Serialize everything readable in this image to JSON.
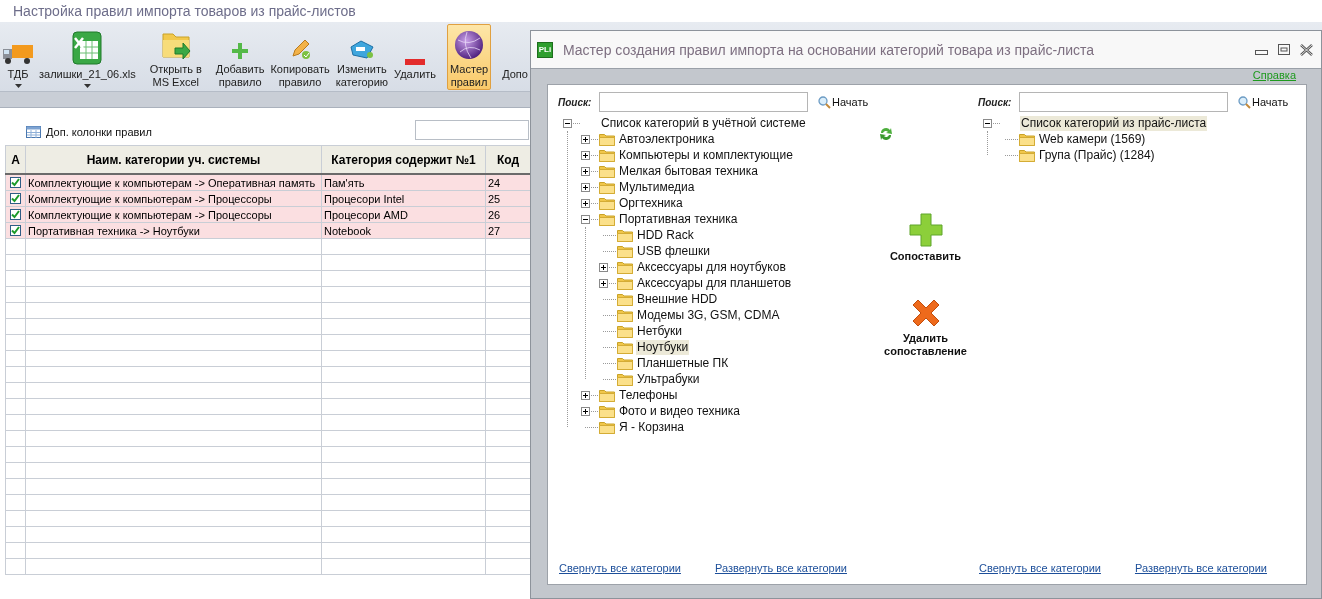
{
  "window": {
    "title": "Настройка правил импорта товаров из прайс-листов"
  },
  "toolbar_groups": [
    [
      {
        "kind": "truck",
        "label": "ТДБ",
        "dropdown": true,
        "selected": false
      },
      {
        "kind": "spreadsheet",
        "label": "залишки_21_06.xls",
        "dropdown": true,
        "selected": false
      }
    ],
    [
      {
        "kind": "folder-arrow",
        "label": "Открыть в\nMS Excel",
        "dropdown": false,
        "selected": false
      }
    ],
    [
      {
        "kind": "plus",
        "label": "Добавить\nправило",
        "dropdown": false,
        "selected": false
      },
      {
        "kind": "pencil",
        "label": "Копировать\nправило",
        "dropdown": false,
        "selected": false
      },
      {
        "kind": "tag",
        "label": "Изменить\nкатегорию",
        "dropdown": false,
        "selected": false
      },
      {
        "kind": "minus",
        "label": "Удалить",
        "dropdown": false,
        "selected": false
      }
    ],
    [
      {
        "kind": "globe",
        "label": "Мастер\nправил",
        "dropdown": false,
        "selected": true
      }
    ],
    [
      {
        "label": "Допо",
        "dropdown": false,
        "selected": false
      }
    ]
  ],
  "extra_columns_button": "Доп. колонки правил",
  "rules_table": {
    "check_column": "А",
    "columns": [
      "Наим. категории уч. системы",
      "Категория содержит №1",
      "Код"
    ],
    "rows": [
      {
        "checked": true,
        "cells": [
          "Комплектующие к компьютерам -> Оперативная память",
          "Пам'ять",
          "24"
        ]
      },
      {
        "checked": true,
        "cells": [
          "Комплектующие к компьютерам -> Процессоры",
          "Процесори Intel",
          "25"
        ]
      },
      {
        "checked": true,
        "cells": [
          "Комплектующие к компьютерам -> Процессоры",
          "Процесори AMD",
          "26"
        ]
      },
      {
        "checked": true,
        "cells": [
          "Портативная техника -> Ноутбуки",
          "Notebook",
          "27"
        ]
      }
    ]
  },
  "dialog": {
    "app_icon": "PLi",
    "title": "Мастер создания правил импорта на основании категорий товара из прайс-листа",
    "help_link": "Справка",
    "panes": [
      {
        "search_label": "Поиск:",
        "search_button": "Начать",
        "collapse_link": "Свернуть все категории",
        "expand_link": "Развернуть все категории",
        "tree": {
          "label": "Список категорий в учётной системе",
          "expanded": true,
          "selected": false,
          "children": [
            {
              "label": "Автоэлектроника",
              "expanded": false,
              "selected": false
            },
            {
              "label": "Компьютеры и комплектующие",
              "expanded": false,
              "selected": false
            },
            {
              "label": "Мелкая бытовая техника",
              "expanded": false,
              "selected": false
            },
            {
              "label": "Мультимедиа",
              "expanded": false,
              "selected": false
            },
            {
              "label": "Оргтехника",
              "expanded": false,
              "selected": false
            },
            {
              "label": "Портативная техника",
              "expanded": true,
              "selected": false,
              "children": [
                {
                  "label": "HDD Rack",
                  "selected": false
                },
                {
                  "label": "USB флешки",
                  "selected": false
                },
                {
                  "label": "Аксессуары для ноутбуков",
                  "expanded": false,
                  "selected": false
                },
                {
                  "label": "Аксессуары для планшетов",
                  "expanded": false,
                  "selected": false
                },
                {
                  "label": "Внешние HDD",
                  "selected": false
                },
                {
                  "label": "Модемы 3G, GSM, CDMA",
                  "selected": false
                },
                {
                  "label": "Нетбуки",
                  "selected": false
                },
                {
                  "label": "Ноутбуки",
                  "selected": true
                },
                {
                  "label": "Планшетные ПК",
                  "selected": false
                },
                {
                  "label": "Ультрабуки",
                  "selected": false
                }
              ]
            },
            {
              "label": "Телефоны",
              "expanded": false,
              "selected": false
            },
            {
              "label": "Фото и видео техника",
              "expanded": false,
              "selected": false
            },
            {
              "label": "Я - Корзина",
              "selected": false
            }
          ]
        }
      },
      {
        "search_label": "Поиск:",
        "search_button": "Начать",
        "collapse_link": "Свернуть все категории",
        "expand_link": "Развернуть все категории",
        "tree": {
          "label": "Список категорий из прайс-листа",
          "expanded": true,
          "selected": true,
          "children": [
            {
              "label": "Web камери (1569)",
              "selected": false
            },
            {
              "label": "Група (Прайс) (1284)",
              "selected": false
            }
          ]
        }
      }
    ],
    "actions": [
      {
        "kind": "add",
        "label": "Сопоставить"
      },
      {
        "kind": "remove",
        "label": "Удалить сопоставление"
      }
    ]
  }
}
